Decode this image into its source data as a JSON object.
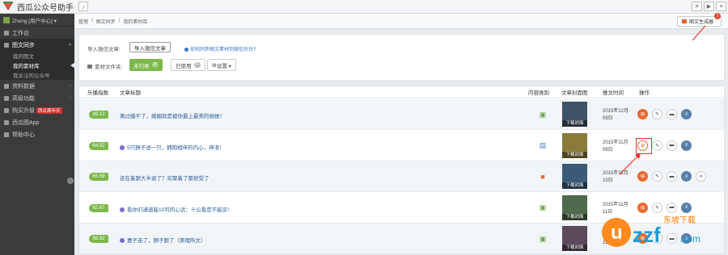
{
  "app": {
    "title": "西瓜公众号助手"
  },
  "colors": {
    "accent": "#7cb84a",
    "sidebar": "#3b3b3b",
    "link": "#2a5d96",
    "warn": "#e8692c"
  },
  "sidebar": {
    "user": "Zheng [用户中心] ▾",
    "items": [
      {
        "label": "工作台",
        "icon": "home-icon"
      },
      {
        "label": "图文同步",
        "icon": "doc-icon",
        "active": true
      },
      {
        "label": "资料数据",
        "icon": "data-icon"
      },
      {
        "label": "高级功能",
        "icon": "star-icon"
      },
      {
        "label": "购买升级",
        "icon": "cart-icon",
        "badge": "西瓜周年庆"
      },
      {
        "label": "西瓜图App",
        "icon": "phone-icon"
      },
      {
        "label": "帮助中心",
        "icon": "help-icon"
      }
    ],
    "sub": [
      {
        "label": "我的图文"
      },
      {
        "label": "我的素材库"
      },
      {
        "label": "我关注的公众号"
      }
    ]
  },
  "breadcrumb": {
    "a": "管理",
    "b": "图文同步",
    "c": "我的素材库"
  },
  "gen_button": {
    "label": "图文生成器",
    "badge": "3"
  },
  "panel": {
    "import_label": "导入微信文章:",
    "import_button": "导入微信文章",
    "help_link": "如何同步图文素材到微信后台?",
    "folder_label": "素材文件夹:",
    "pending": {
      "label": "未归类",
      "count": "97"
    },
    "used": {
      "label": "已使用",
      "count": "0"
    },
    "settings": "设置 ▾"
  },
  "table": {
    "headers": [
      "乐播指数",
      "文章标题",
      "内容类别",
      "文章封面图",
      "推文时间",
      "操作"
    ],
    "rows": [
      {
        "score": "69.12",
        "title": "离过婚不了，婚姻就是被你最上最美的她她！",
        "type": "image",
        "cover": "下载封面",
        "date_l1": "2015年12月",
        "date_l2": "09日"
      },
      {
        "score": "64.52",
        "title": "5只狮子送一只，拥抱相伴的内心，神湛！",
        "type": "doc",
        "cover": "下载封面",
        "date_l1": "2015年11月",
        "date_l2": "09日"
      },
      {
        "score": "65.59",
        "title": "还在着跟大半退了？欢聚着了都很受了",
        "type": "video",
        "cover": "下载封面",
        "date_l1": "2015年11月",
        "date_l2": "10日"
      },
      {
        "score": "62.67",
        "title": "看你们通道能10可的心话：十公看是不能买!",
        "type": "image",
        "cover": "下载封面",
        "date_l1": "2015年11月",
        "date_l2": "11日"
      },
      {
        "score": "66.82",
        "title": "妻子走了，狮子跟了（原理所文）",
        "type": "image",
        "cover": "下载封面",
        "date_l1": "2015年11月",
        "date_l2": "11日"
      }
    ]
  },
  "watermark": {
    "text": "uzzf.com",
    "sub": "东坡下载"
  }
}
